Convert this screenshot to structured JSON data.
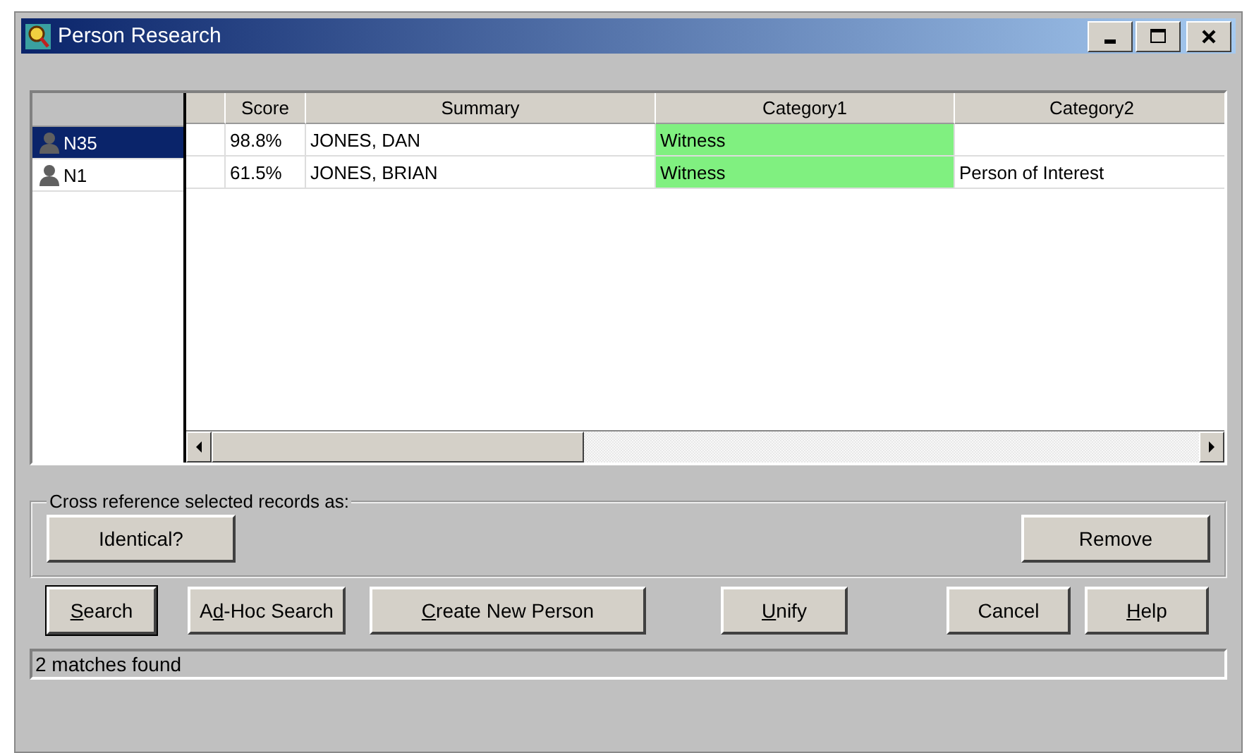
{
  "window": {
    "title": "Person Research"
  },
  "title_buttons": [
    {
      "kind": "minimize"
    },
    {
      "kind": "maximize"
    },
    {
      "kind": "close"
    }
  ],
  "records": [
    {
      "id_label": "N35",
      "selected": true
    },
    {
      "id_label": "N1",
      "selected": false
    }
  ],
  "table": {
    "columns": [
      "",
      "Score",
      "Summary",
      "Category1",
      "Category2"
    ],
    "rows": [
      {
        "cells": [
          {
            "text": ""
          },
          {
            "text": "98.8%"
          },
          {
            "text": "JONES, DAN"
          },
          {
            "text": "Witness",
            "color": "#80f080"
          },
          {
            "text": ""
          }
        ]
      },
      {
        "cells": [
          {
            "text": ""
          },
          {
            "text": "61.5%"
          },
          {
            "text": "JONES, BRIAN"
          },
          {
            "text": "Witness",
            "color": "#80f080"
          },
          {
            "text": "Person of Interest"
          }
        ]
      }
    ]
  },
  "cross_reference": {
    "legend": "Cross reference selected records as:",
    "buttons": [
      {
        "parts": [
          {
            "t": "Identical?"
          }
        ]
      },
      {
        "parts": [
          {
            "t": "Remove"
          }
        ]
      }
    ]
  },
  "buttons": [
    {
      "parts": [
        {
          "t": "S",
          "u": true
        },
        {
          "t": "earch"
        }
      ],
      "default": true
    },
    {
      "parts": [
        {
          "t": "A"
        },
        {
          "t": "d",
          "u": true
        },
        {
          "t": "-Hoc Search"
        }
      ],
      "default": false
    },
    {
      "parts": [
        {
          "t": "C",
          "u": true
        },
        {
          "t": "reate New Person"
        }
      ],
      "default": false
    },
    {
      "parts": [
        {
          "t": "U",
          "u": true
        },
        {
          "t": "nify"
        }
      ],
      "default": false
    },
    {
      "parts": [
        {
          "t": "Cancel"
        }
      ],
      "default": false
    },
    {
      "parts": [
        {
          "t": "H",
          "u": true
        },
        {
          "t": "elp"
        }
      ],
      "default": false
    }
  ],
  "status_bar": "2 matches found"
}
